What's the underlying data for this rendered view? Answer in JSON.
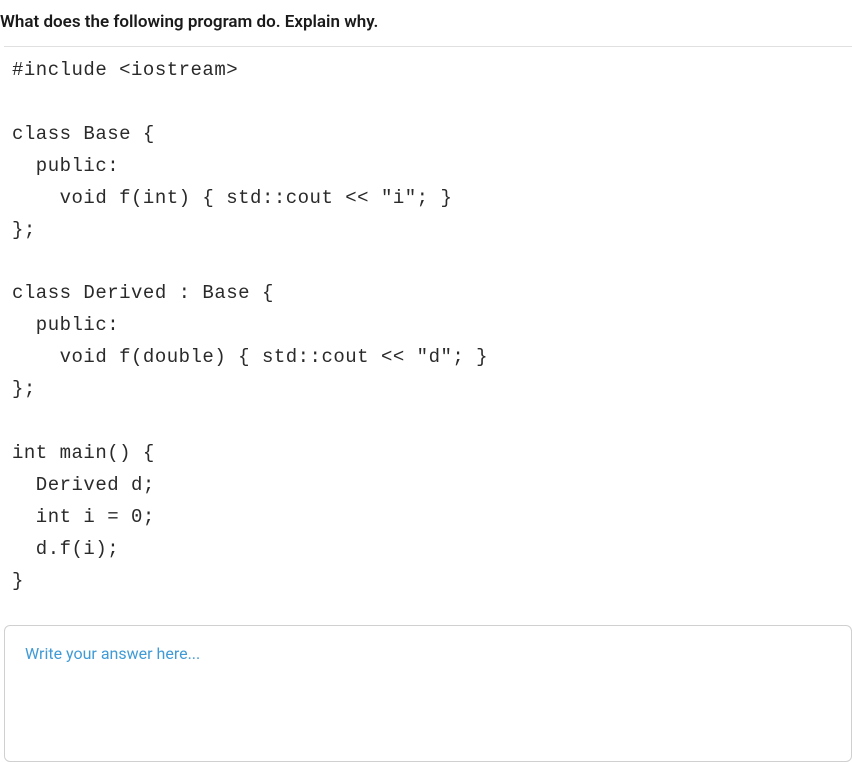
{
  "question": {
    "title": "What does the following program do. Explain why."
  },
  "code": {
    "lines": [
      "#include <iostream>",
      "",
      "class Base {",
      "  public:",
      "    void f(int) { std::cout << \"i\"; }",
      "};",
      "",
      "class Derived : Base {",
      "  public:",
      "    void f(double) { std::cout << \"d\"; }",
      "};",
      "",
      "int main() {",
      "  Derived d;",
      "  int i = 0;",
      "  d.f(i);",
      "}"
    ]
  },
  "answer": {
    "placeholder": "Write your answer here...",
    "value": ""
  }
}
